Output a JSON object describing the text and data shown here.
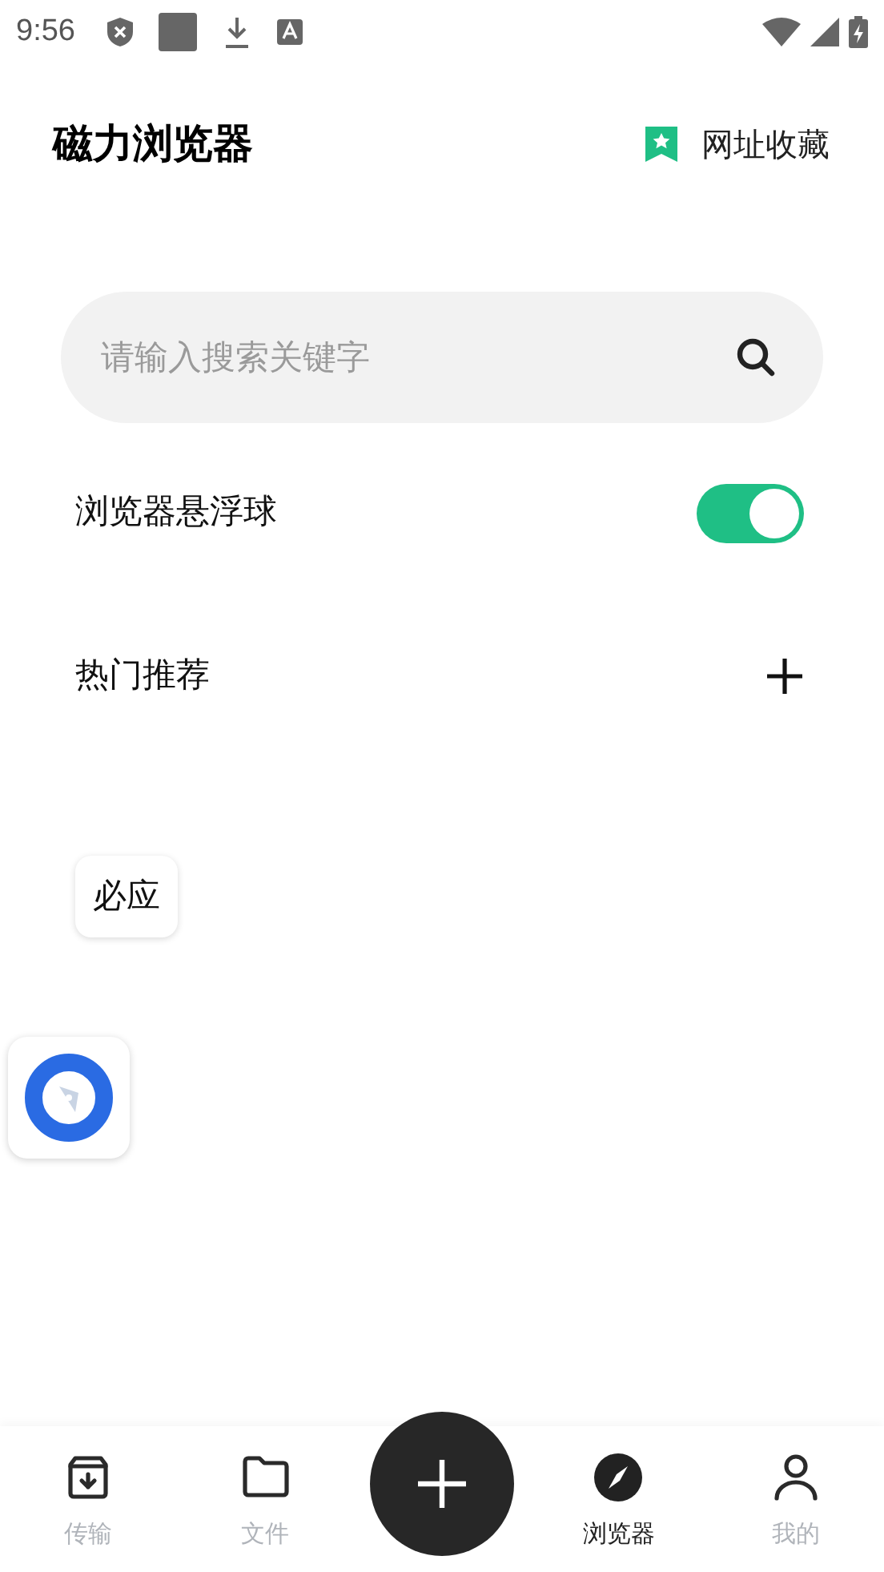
{
  "status_bar": {
    "time": "9:56"
  },
  "header": {
    "title": "磁力浏览器",
    "bookmarks_label": "网址收藏"
  },
  "search": {
    "placeholder": "请输入搜索关键字"
  },
  "settings": [
    {
      "label": "浏览器悬浮球",
      "on": true
    }
  ],
  "hot": {
    "label": "热门推荐",
    "items": [
      {
        "label": "必应"
      }
    ]
  },
  "bottom_nav": [
    {
      "label": "传输",
      "kind": "transfer",
      "selected": false
    },
    {
      "label": "文件",
      "kind": "files",
      "selected": false
    },
    {
      "kind": "add"
    },
    {
      "label": "浏览器",
      "kind": "browser",
      "selected": true
    },
    {
      "label": "我的",
      "kind": "me",
      "selected": false
    }
  ]
}
